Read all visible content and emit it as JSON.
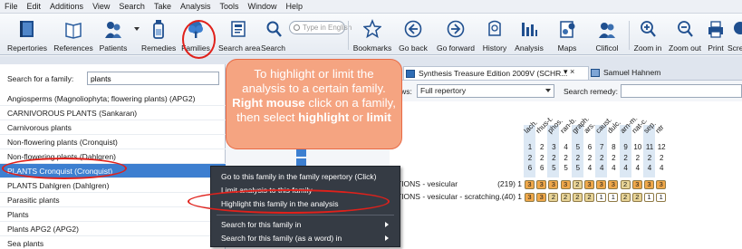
{
  "menu_bar": [
    "File",
    "Edit",
    "Additions",
    "View",
    "Search",
    "Take",
    "Analysis",
    "Tools",
    "Window",
    "Help"
  ],
  "toolbar": {
    "repertories": "Repertories",
    "references": "References",
    "patients": "Patients",
    "remedies": "Remedies",
    "families": "Families",
    "search_area": "Search area",
    "search": "Search",
    "search_placeholder": "Type in English",
    "bookmarks": "Bookmarks",
    "go_back": "Go back",
    "go_forward": "Go forward",
    "history": "History",
    "analysis": "Analysis",
    "maps": "Maps",
    "clificol": "Clificol",
    "zoom_in": "Zoom in",
    "zoom_out": "Zoom out",
    "print": "Print",
    "screen": "Scree"
  },
  "family_panel": {
    "search_label": "Search for a family:",
    "search_value": "plants",
    "items": [
      "Angiosperms (Magnoliophyta; flowering plants) (APG2)",
      "CARNIVOROUS PLANTS (Sankaran)",
      "Carnivorous plants",
      "Non-flowering plants (Cronquist)",
      "Non-flowering plants (Dahlgren)",
      "PLANTS Cronquist (Cronquist)",
      "PLANTS Dahlgren (Dahlgren)",
      "Parasitic plants",
      "Plants",
      "Plants APG2 (APG2)",
      "Sea plants"
    ]
  },
  "tabs": {
    "close_left": "×",
    "repertory_tab": "Synthesis Treasure Edition 2009V (SCHR...",
    "repertory_close": "▾  ×",
    "author_tab": "Samuel Hahnem"
  },
  "views": {
    "label": "Views:",
    "value": "Full repertory",
    "search_remedy_label": "Search remedy:"
  },
  "repertory": {
    "remedies": [
      "lach.",
      "rhus-t.",
      "phos.",
      "ran-b.",
      "graph.",
      "ars.",
      "caust.",
      "dulc.",
      "arn-m.",
      "nat-c.",
      "sep.",
      "ntr"
    ],
    "col_numbers": [
      "1",
      "2",
      "3",
      "4",
      "5",
      "6",
      "7",
      "8",
      "9",
      "10",
      "11",
      "12"
    ],
    "row_totals": [
      "2",
      "2",
      "2",
      "2",
      "2",
      "2",
      "2",
      "2",
      "2",
      "2",
      "2",
      "2"
    ],
    "row_counts": [
      "6",
      "6",
      "5",
      "5",
      "5",
      "4",
      "4",
      "4",
      "4",
      "4",
      "4",
      "4"
    ],
    "rubrics": [
      {
        "text": "TIONS - vesicular",
        "count": "(219) 1",
        "grades": [
          "3",
          "3",
          "3",
          "3",
          "2",
          "3",
          "3",
          "3",
          "2",
          "3",
          "3",
          "3"
        ]
      },
      {
        "text": "TIONS - vesicular - scratching...",
        "count": "(40) 1",
        "grades": [
          "3",
          "3",
          "2",
          "2",
          "2",
          "2",
          "1",
          "1",
          "2",
          "2",
          "1",
          "1"
        ]
      }
    ]
  },
  "context_menu": {
    "go_to": "Go to this family in the family repertory (Click)",
    "limit": "Limit analysis to this family",
    "highlight": "Highlight this family in the analysis",
    "search_in": "Search for this family in",
    "search_word": "Search for this family (as a word) in"
  },
  "callout": {
    "line1": "To highlight or limit the",
    "line2": "analysis to a certain family.",
    "line3_bold": "Right mouse",
    "line3_rest": " click on a family,",
    "line4_pre": "then select ",
    "line4_bold1": "highlight",
    "line4_mid": " or ",
    "line4_bold2": "limit"
  },
  "colors": {
    "selection_blue": "#3d7fd0",
    "callout_fill": "#f5a481",
    "annotation_red": "#e0211b",
    "menu_dark": "#353b44"
  }
}
